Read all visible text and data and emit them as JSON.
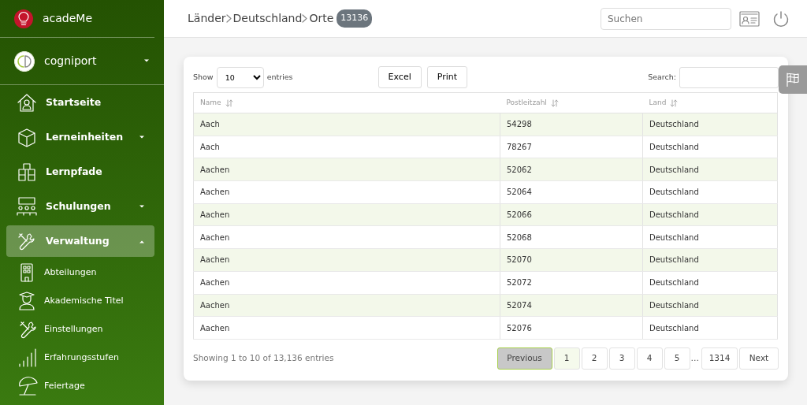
{
  "sidebar": {
    "brand": "acadeMe",
    "account": {
      "label": "cogniport",
      "expanded": false
    },
    "items": [
      {
        "label": "Startseite",
        "kind": "main",
        "selected": false
      },
      {
        "label": "Lerneinheiten",
        "kind": "main",
        "selected": false,
        "expanded": false
      },
      {
        "label": "Lernpfade",
        "kind": "main",
        "selected": false
      },
      {
        "label": "Schulungen",
        "kind": "main",
        "selected": false,
        "expanded": false
      },
      {
        "label": "Verwaltung",
        "kind": "main",
        "selected": true,
        "expanded": true
      },
      {
        "label": "Abteilungen",
        "kind": "sub",
        "selected": false
      },
      {
        "label": "Akademische Titel",
        "kind": "sub",
        "selected": false
      },
      {
        "label": "Einstellungen",
        "kind": "sub",
        "selected": false
      },
      {
        "label": "Erfahrungsstufen",
        "kind": "sub",
        "selected": false
      },
      {
        "label": "Feiertage",
        "kind": "sub",
        "selected": false
      }
    ]
  },
  "header": {
    "breadcrumb": [
      "Länder",
      "Deutschland",
      "Orte"
    ],
    "count_badge": "13136",
    "search": {
      "placeholder": "Suchen"
    }
  },
  "table_controls": {
    "show_label": "Show",
    "page_size": "10",
    "entries_label": "entries",
    "buttons": [
      "Excel",
      "Print"
    ],
    "search_label": "Search:"
  },
  "table": {
    "columns": [
      "Name",
      "Postleitzahl",
      "Land"
    ],
    "rows": [
      [
        "Aach",
        "54298",
        "Deutschland"
      ],
      [
        "Aach",
        "78267",
        "Deutschland"
      ],
      [
        "Aachen",
        "52062",
        "Deutschland"
      ],
      [
        "Aachen",
        "52064",
        "Deutschland"
      ],
      [
        "Aachen",
        "52066",
        "Deutschland"
      ],
      [
        "Aachen",
        "52068",
        "Deutschland"
      ],
      [
        "Aachen",
        "52070",
        "Deutschland"
      ],
      [
        "Aachen",
        "52072",
        "Deutschland"
      ],
      [
        "Aachen",
        "52074",
        "Deutschland"
      ],
      [
        "Aachen",
        "52076",
        "Deutschland"
      ]
    ]
  },
  "footer": {
    "info": "Showing 1 to 10 of 13,136 entries",
    "pagination": [
      {
        "label": "Previous",
        "kind": "prev",
        "disabled": true
      },
      {
        "label": "1",
        "kind": "page",
        "selected": true
      },
      {
        "label": "2",
        "kind": "page",
        "selected": false
      },
      {
        "label": "3",
        "kind": "page",
        "selected": false
      },
      {
        "label": "4",
        "kind": "page",
        "selected": false
      },
      {
        "label": "5",
        "kind": "page",
        "selected": false
      },
      {
        "label": "…",
        "kind": "ellipsis"
      },
      {
        "label": "1314",
        "kind": "page",
        "selected": false
      },
      {
        "label": "Next",
        "kind": "next",
        "disabled": false
      }
    ]
  }
}
